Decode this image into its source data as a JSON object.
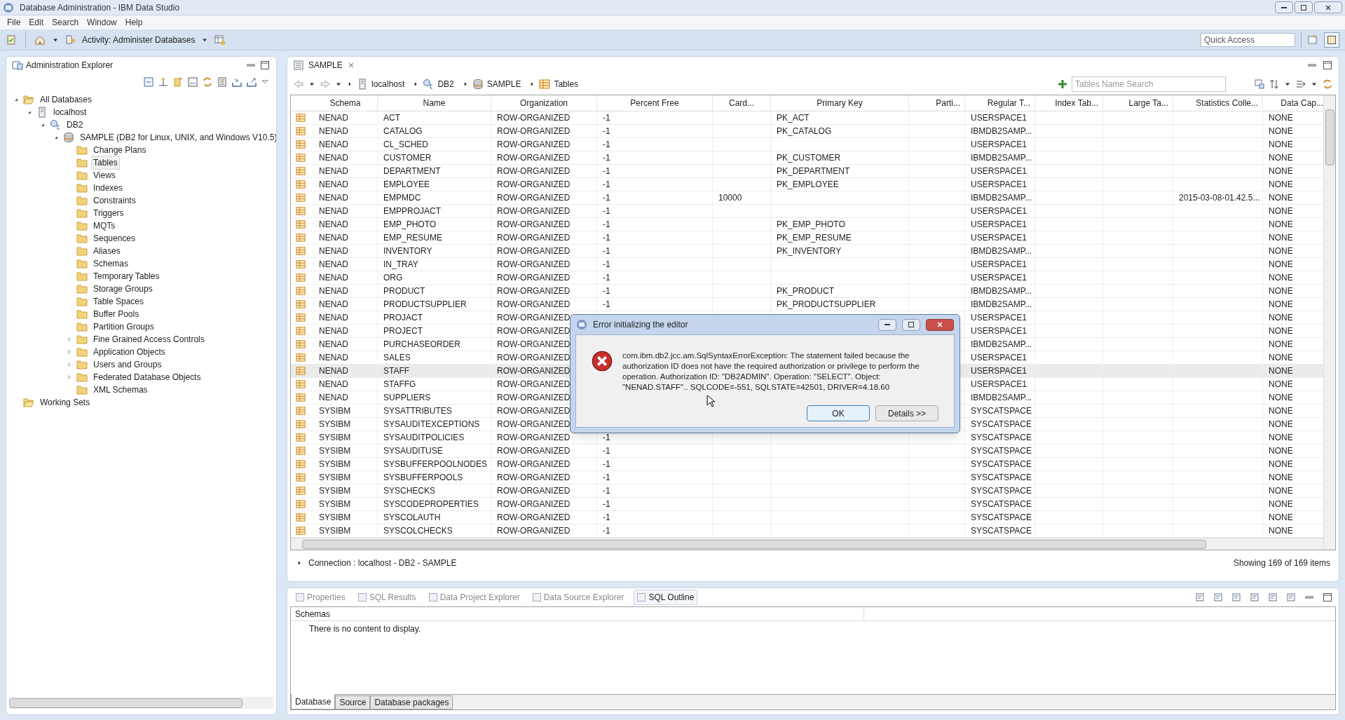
{
  "window": {
    "title": "Database Administration - IBM Data Studio"
  },
  "menu": [
    "File",
    "Edit",
    "Search",
    "Window",
    "Help"
  ],
  "toolbar": {
    "activity": "Activity: Administer Databases",
    "quick_access": {
      "placeholder": "Quick Access"
    }
  },
  "explorer": {
    "title": "Administration Explorer",
    "tree": [
      {
        "label": "All Databases",
        "kind": "folder-open",
        "expanded": true,
        "selected": false,
        "children": [
          {
            "label": "localhost",
            "kind": "host",
            "expanded": true,
            "selected": false,
            "children": [
              {
                "label": "DB2",
                "kind": "instance",
                "expanded": true,
                "selected": false,
                "children": [
                  {
                    "label": "SAMPLE (DB2 for Linux, UNIX, and Windows V10.5)",
                    "kind": "database",
                    "expanded": true,
                    "selected": false,
                    "children": [
                      {
                        "label": "Change Plans",
                        "kind": "folder",
                        "selected": false
                      },
                      {
                        "label": "Tables",
                        "kind": "folder",
                        "selected": true
                      },
                      {
                        "label": "Views",
                        "kind": "folder",
                        "selected": false
                      },
                      {
                        "label": "Indexes",
                        "kind": "folder",
                        "selected": false
                      },
                      {
                        "label": "Constraints",
                        "kind": "folder",
                        "selected": false
                      },
                      {
                        "label": "Triggers",
                        "kind": "folder",
                        "selected": false
                      },
                      {
                        "label": "MQTs",
                        "kind": "folder",
                        "selected": false
                      },
                      {
                        "label": "Sequences",
                        "kind": "folder",
                        "selected": false
                      },
                      {
                        "label": "Aliases",
                        "kind": "folder",
                        "selected": false
                      },
                      {
                        "label": "Schemas",
                        "kind": "folder",
                        "selected": false
                      },
                      {
                        "label": "Temporary Tables",
                        "kind": "folder",
                        "selected": false
                      },
                      {
                        "label": "Storage Groups",
                        "kind": "folder",
                        "selected": false
                      },
                      {
                        "label": "Table Spaces",
                        "kind": "folder",
                        "selected": false
                      },
                      {
                        "label": "Buffer Pools",
                        "kind": "folder",
                        "selected": false
                      },
                      {
                        "label": "Partition Groups",
                        "kind": "folder",
                        "selected": false
                      },
                      {
                        "label": "Fine Grained Access Controls",
                        "kind": "folder",
                        "expanded": false,
                        "selected": false
                      },
                      {
                        "label": "Application Objects",
                        "kind": "folder",
                        "expanded": false,
                        "selected": false
                      },
                      {
                        "label": "Users and Groups",
                        "kind": "folder",
                        "expanded": false,
                        "selected": false
                      },
                      {
                        "label": "Federated Database Objects",
                        "kind": "folder",
                        "expanded": false,
                        "selected": false
                      },
                      {
                        "label": "XML Schemas",
                        "kind": "folder",
                        "selected": false
                      }
                    ]
                  }
                ]
              }
            ]
          }
        ]
      },
      {
        "label": "Working Sets",
        "kind": "folder-open",
        "selected": false
      }
    ]
  },
  "editor": {
    "tab": {
      "label": "SAMPLE"
    },
    "breadcrumb": [
      {
        "label": "localhost",
        "kind": "host"
      },
      {
        "label": "DB2",
        "kind": "instance"
      },
      {
        "label": "SAMPLE",
        "kind": "database"
      },
      {
        "label": "Tables",
        "kind": "table"
      }
    ],
    "search": {
      "placeholder": "Tables Name Search"
    },
    "table": {
      "columns": [
        "Schema",
        "Name",
        "Organization",
        "Percent Free",
        "Card...",
        "Primary Key",
        "Parti...",
        "Regular T...",
        "Index Tab...",
        "Large Ta...",
        "Statistics Colle...",
        "Data Cap..."
      ],
      "rows": [
        {
          "schema": "NENAD",
          "name": "ACT",
          "organization": "ROW-ORGANIZED",
          "percent_free": "-1",
          "primary_key": "PK_ACT",
          "regular_tablespace": "USERSPACE1",
          "data_capture": "NONE",
          "selected": false
        },
        {
          "schema": "NENAD",
          "name": "CATALOG",
          "organization": "ROW-ORGANIZED",
          "percent_free": "-1",
          "primary_key": "PK_CATALOG",
          "regular_tablespace": "IBMDB2SAMP...",
          "data_capture": "NONE",
          "selected": false
        },
        {
          "schema": "NENAD",
          "name": "CL_SCHED",
          "organization": "ROW-ORGANIZED",
          "percent_free": "-1",
          "regular_tablespace": "USERSPACE1",
          "data_capture": "NONE",
          "selected": false
        },
        {
          "schema": "NENAD",
          "name": "CUSTOMER",
          "organization": "ROW-ORGANIZED",
          "percent_free": "-1",
          "primary_key": "PK_CUSTOMER",
          "regular_tablespace": "IBMDB2SAMP...",
          "data_capture": "NONE",
          "selected": false
        },
        {
          "schema": "NENAD",
          "name": "DEPARTMENT",
          "organization": "ROW-ORGANIZED",
          "percent_free": "-1",
          "primary_key": "PK_DEPARTMENT",
          "regular_tablespace": "USERSPACE1",
          "data_capture": "NONE",
          "selected": false
        },
        {
          "schema": "NENAD",
          "name": "EMPLOYEE",
          "organization": "ROW-ORGANIZED",
          "percent_free": "-1",
          "primary_key": "PK_EMPLOYEE",
          "regular_tablespace": "USERSPACE1",
          "data_capture": "NONE",
          "selected": false
        },
        {
          "schema": "NENAD",
          "name": "EMPMDC",
          "organization": "ROW-ORGANIZED",
          "percent_free": "-1",
          "card": "10000",
          "regular_tablespace": "IBMDB2SAMP...",
          "statistics_collected": "2015-03-08-01.42.5...",
          "data_capture": "NONE",
          "selected": false
        },
        {
          "schema": "NENAD",
          "name": "EMPPROJACT",
          "organization": "ROW-ORGANIZED",
          "percent_free": "-1",
          "regular_tablespace": "USERSPACE1",
          "data_capture": "NONE",
          "selected": false
        },
        {
          "schema": "NENAD",
          "name": "EMP_PHOTO",
          "organization": "ROW-ORGANIZED",
          "percent_free": "-1",
          "primary_key": "PK_EMP_PHOTO",
          "regular_tablespace": "USERSPACE1",
          "data_capture": "NONE",
          "selected": false
        },
        {
          "schema": "NENAD",
          "name": "EMP_RESUME",
          "organization": "ROW-ORGANIZED",
          "percent_free": "-1",
          "primary_key": "PK_EMP_RESUME",
          "regular_tablespace": "USERSPACE1",
          "data_capture": "NONE",
          "selected": false
        },
        {
          "schema": "NENAD",
          "name": "INVENTORY",
          "organization": "ROW-ORGANIZED",
          "percent_free": "-1",
          "primary_key": "PK_INVENTORY",
          "regular_tablespace": "IBMDB2SAMP...",
          "data_capture": "NONE",
          "selected": false
        },
        {
          "schema": "NENAD",
          "name": "IN_TRAY",
          "organization": "ROW-ORGANIZED",
          "percent_free": "-1",
          "regular_tablespace": "USERSPACE1",
          "data_capture": "NONE",
          "selected": false
        },
        {
          "schema": "NENAD",
          "name": "ORG",
          "organization": "ROW-ORGANIZED",
          "percent_free": "-1",
          "regular_tablespace": "USERSPACE1",
          "data_capture": "NONE",
          "selected": false
        },
        {
          "schema": "NENAD",
          "name": "PRODUCT",
          "organization": "ROW-ORGANIZED",
          "percent_free": "-1",
          "primary_key": "PK_PRODUCT",
          "regular_tablespace": "IBMDB2SAMP...",
          "data_capture": "NONE",
          "selected": false
        },
        {
          "schema": "NENAD",
          "name": "PRODUCTSUPPLIER",
          "organization": "ROW-ORGANIZED",
          "percent_free": "-1",
          "primary_key": "PK_PRODUCTSUPPLIER",
          "regular_tablespace": "IBMDB2SAMP...",
          "data_capture": "NONE",
          "selected": false
        },
        {
          "schema": "NENAD",
          "name": "PROJACT",
          "organization": "ROW-ORGANIZED",
          "regular_tablespace": "USERSPACE1",
          "data_capture": "NONE",
          "selected": false
        },
        {
          "schema": "NENAD",
          "name": "PROJECT",
          "organization": "ROW-ORGANIZED",
          "regular_tablespace": "USERSPACE1",
          "data_capture": "NONE",
          "selected": false
        },
        {
          "schema": "NENAD",
          "name": "PURCHASEORDER",
          "organization": "ROW-ORGANIZED",
          "regular_tablespace": "IBMDB2SAMP...",
          "data_capture": "NONE",
          "selected": false
        },
        {
          "schema": "NENAD",
          "name": "SALES",
          "organization": "ROW-ORGANIZED",
          "regular_tablespace": "USERSPACE1",
          "data_capture": "NONE",
          "selected": false
        },
        {
          "schema": "NENAD",
          "name": "STAFF",
          "organization": "ROW-ORGANIZED",
          "regular_tablespace": "USERSPACE1",
          "data_capture": "NONE",
          "selected": true
        },
        {
          "schema": "NENAD",
          "name": "STAFFG",
          "organization": "ROW-ORGANIZED",
          "regular_tablespace": "USERSPACE1",
          "data_capture": "NONE",
          "selected": false
        },
        {
          "schema": "NENAD",
          "name": "SUPPLIERS",
          "organization": "ROW-ORGANIZED",
          "regular_tablespace": "IBMDB2SAMP...",
          "data_capture": "NONE",
          "selected": false
        },
        {
          "schema": "SYSIBM",
          "name": "SYSATTRIBUTES",
          "organization": "ROW-ORGANIZED",
          "regular_tablespace": "SYSCATSPACE",
          "data_capture": "NONE",
          "selected": false
        },
        {
          "schema": "SYSIBM",
          "name": "SYSAUDITEXCEPTIONS",
          "organization": "ROW-ORGANIZED",
          "regular_tablespace": "SYSCATSPACE",
          "data_capture": "NONE",
          "selected": false
        },
        {
          "schema": "SYSIBM",
          "name": "SYSAUDITPOLICIES",
          "organization": "ROW-ORGANIZED",
          "percent_free": "-1",
          "regular_tablespace": "SYSCATSPACE",
          "data_capture": "NONE",
          "selected": false
        },
        {
          "schema": "SYSIBM",
          "name": "SYSAUDITUSE",
          "organization": "ROW-ORGANIZED",
          "percent_free": "-1",
          "regular_tablespace": "SYSCATSPACE",
          "data_capture": "NONE",
          "selected": false
        },
        {
          "schema": "SYSIBM",
          "name": "SYSBUFFERPOOLNODES",
          "organization": "ROW-ORGANIZED",
          "percent_free": "-1",
          "regular_tablespace": "SYSCATSPACE",
          "data_capture": "NONE",
          "selected": false
        },
        {
          "schema": "SYSIBM",
          "name": "SYSBUFFERPOOLS",
          "organization": "ROW-ORGANIZED",
          "percent_free": "-1",
          "regular_tablespace": "SYSCATSPACE",
          "data_capture": "NONE",
          "selected": false
        },
        {
          "schema": "SYSIBM",
          "name": "SYSCHECKS",
          "organization": "ROW-ORGANIZED",
          "percent_free": "-1",
          "regular_tablespace": "SYSCATSPACE",
          "data_capture": "NONE",
          "selected": false
        },
        {
          "schema": "SYSIBM",
          "name": "SYSCODEPROPERTIES",
          "organization": "ROW-ORGANIZED",
          "percent_free": "-1",
          "regular_tablespace": "SYSCATSPACE",
          "data_capture": "NONE",
          "selected": false
        },
        {
          "schema": "SYSIBM",
          "name": "SYSCOLAUTH",
          "organization": "ROW-ORGANIZED",
          "percent_free": "-1",
          "regular_tablespace": "SYSCATSPACE",
          "data_capture": "NONE",
          "selected": false
        },
        {
          "schema": "SYSIBM",
          "name": "SYSCOLCHECKS",
          "organization": "ROW-ORGANIZED",
          "percent_free": "-1",
          "regular_tablespace": "SYSCATSPACE",
          "data_capture": "NONE",
          "selected": false
        }
      ]
    },
    "connection": "Connection : localhost - DB2 - SAMPLE",
    "item_count": "Showing 169 of 169 items"
  },
  "bottom_panel": {
    "tabs": [
      {
        "label": "Properties",
        "selected": false
      },
      {
        "label": "SQL Results",
        "selected": false
      },
      {
        "label": "Data Project Explorer",
        "selected": false
      },
      {
        "label": "Data Source Explorer",
        "selected": false
      },
      {
        "label": "SQL Outline",
        "selected": true
      }
    ],
    "column": "Schemas",
    "empty_message": "There is no content to display.",
    "subtabs": [
      {
        "label": "Database",
        "selected": true
      },
      {
        "label": "Source",
        "selected": false
      },
      {
        "label": "Database packages",
        "selected": false
      }
    ]
  },
  "dialog": {
    "title": "Error initializing the editor",
    "message": "com.ibm.db2.jcc.am.SqlSyntaxErrorException: The statement failed because the authorization ID does not have the required authorization or privilege to perform the operation.  Authorization ID: \"DB2ADMIN\".  Operation: \"SELECT\". Object: \"NENAD.STAFF\".. SQLCODE=-551, SQLSTATE=42501, DRIVER=4.18.60",
    "buttons": [
      {
        "label": "OK",
        "default": true
      },
      {
        "label": "Details >>",
        "default": false
      }
    ]
  }
}
